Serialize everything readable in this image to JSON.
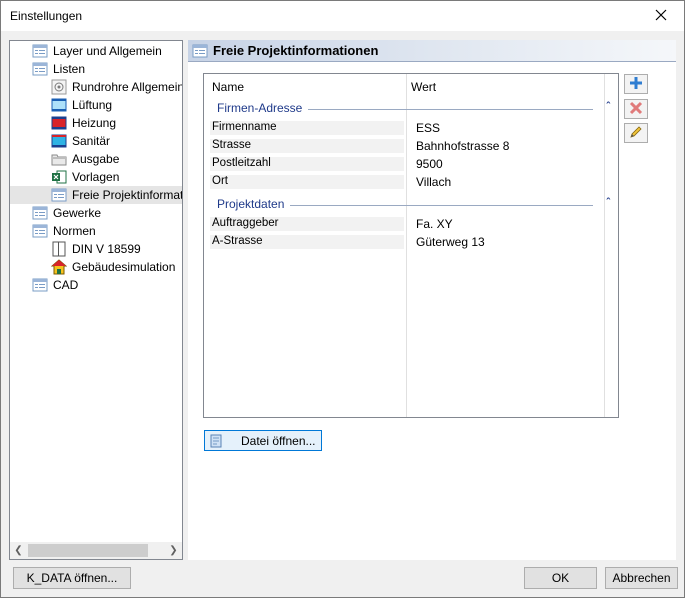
{
  "window": {
    "title": "Einstellungen"
  },
  "tree": {
    "items": [
      {
        "label": "Layer und Allgemein",
        "level": 0
      },
      {
        "label": "Listen",
        "level": 0
      },
      {
        "label": "Rundrohre Allgemein",
        "level": 1
      },
      {
        "label": "Lüftung",
        "level": 1
      },
      {
        "label": "Heizung",
        "level": 1
      },
      {
        "label": "Sanitär",
        "level": 1
      },
      {
        "label": "Ausgabe",
        "level": 1
      },
      {
        "label": "Vorlagen",
        "level": 1
      },
      {
        "label": "Freie Projektinformationen",
        "level": 1,
        "selected": true
      },
      {
        "label": "Gewerke",
        "level": 0
      },
      {
        "label": "Normen",
        "level": 0
      },
      {
        "label": "DIN V 18599",
        "level": 1
      },
      {
        "label": "Gebäudesimulation",
        "level": 1
      },
      {
        "label": "CAD",
        "level": 0
      }
    ]
  },
  "panel": {
    "title": "Freie Projektinformationen",
    "columns": {
      "name": "Name",
      "value": "Wert"
    },
    "groups": [
      {
        "label": "Firmen-Adresse",
        "rows": [
          {
            "name": "Firmenname",
            "value": "ESS"
          },
          {
            "name": "Strasse",
            "value": "Bahnhofstrasse 8"
          },
          {
            "name": "Postleitzahl",
            "value": "9500"
          },
          {
            "name": "Ort",
            "value": "Villach"
          }
        ]
      },
      {
        "label": "Projektdaten",
        "rows": [
          {
            "name": "Auftraggeber",
            "value": "Fa. XY"
          },
          {
            "name": "A-Strasse",
            "value": "Güterweg 13"
          }
        ]
      }
    ],
    "file_button": "Datei öffnen..."
  },
  "buttons": {
    "k_data": "K_DATA öffnen...",
    "ok": "OK",
    "cancel": "Abbrechen"
  },
  "icons": {
    "add": "plus-icon",
    "delete": "delete-icon",
    "edit": "pencil-icon"
  },
  "colors": {
    "accent": "#1f3a8a",
    "selection": "#e5e5e5"
  }
}
